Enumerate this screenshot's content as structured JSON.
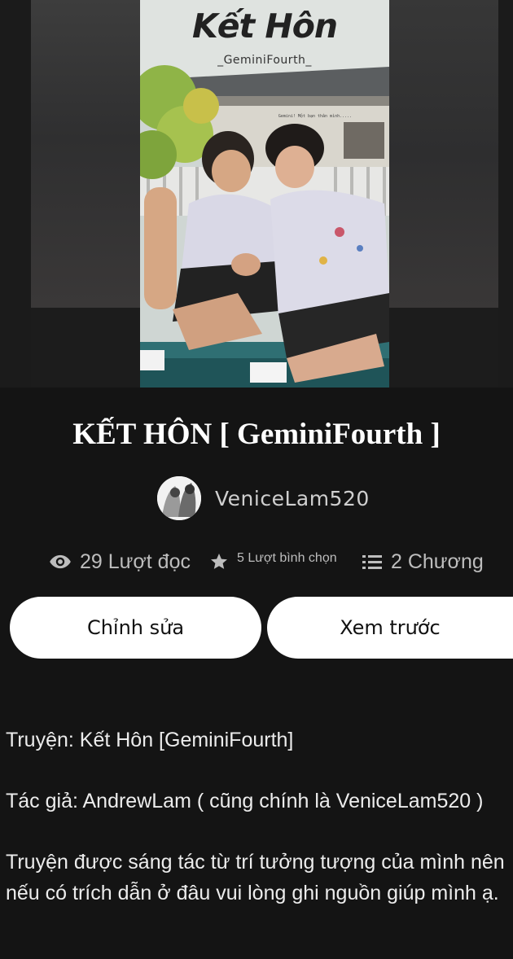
{
  "cover": {
    "title": "Kết Hôn",
    "author_tag": "_GeminiFourth_",
    "caption": "Gemini! Một bạn thân mình....."
  },
  "story": {
    "title": "KẾT HÔN [ GeminiFourth ]",
    "author": "VeniceLam520"
  },
  "stats": {
    "reads": "29 Lượt đọc",
    "votes": "5 Lượt bình chọn",
    "chapters": "2 Chương",
    "reads_icon": "eye-icon",
    "votes_icon": "star-icon",
    "chapters_icon": "list-icon"
  },
  "actions": {
    "edit_label": "Chỉnh sửa",
    "preview_label": "Xem trước"
  },
  "description": {
    "line_title": "Truyện: Kết Hôn [GeminiFourth]",
    "line_author": "Tác giả: AndrewLam ( cũng chính là VeniceLam520 )",
    "line_body": "Truyện được sáng tác từ trí tưởng tượng của mình nên nếu có trích dẫn ở đâu vui lòng ghi nguồn giúp mình ạ."
  },
  "colors": {
    "background": "#141414",
    "button": "#ffffff",
    "text_muted": "#bdbdbd"
  }
}
